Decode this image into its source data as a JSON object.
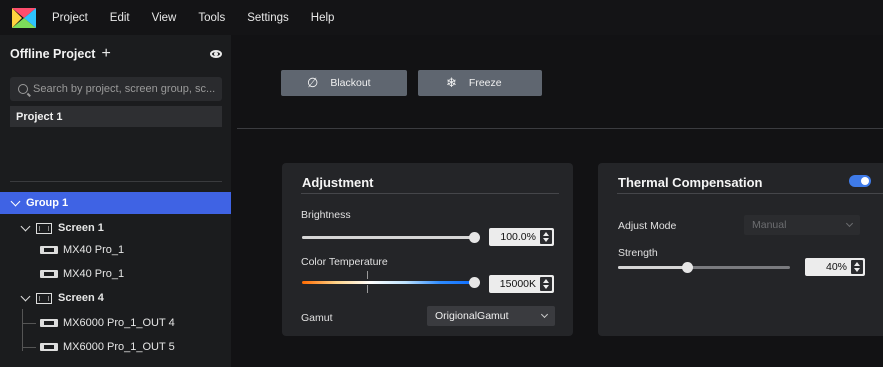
{
  "menu": {
    "items": [
      "Project",
      "Edit",
      "View",
      "Tools",
      "Settings",
      "Help"
    ]
  },
  "sidebar": {
    "title": "Offline Project",
    "add_icon": "plus-icon",
    "visibility_icon": "eye-icon",
    "search_placeholder": "Search by project, screen group, sc...",
    "projects": [
      {
        "label": "Project 1"
      }
    ],
    "tree": {
      "group": "Group 1",
      "screens": [
        {
          "label": "Screen 1",
          "children": [
            "MX40 Pro_1",
            "MX40 Pro_1"
          ]
        },
        {
          "label": "Screen 4",
          "children": [
            "MX6000 Pro_1_OUT 4",
            "MX6000 Pro_1_OUT 5"
          ]
        }
      ]
    }
  },
  "toolbar": {
    "blackout_label": "Blackout",
    "freeze_label": "Freeze"
  },
  "adjustment": {
    "title": "Adjustment",
    "brightness_label": "Brightness",
    "brightness_value": "100.0%",
    "brightness_level": 1.0,
    "color_temp_label": "Color Temperature",
    "color_temp_value": "15000K",
    "color_temp_level": 1.0,
    "gamut_label": "Gamut",
    "gamut_value": "OrigionalGamut"
  },
  "thermal": {
    "title": "Thermal Compensation",
    "enabled": true,
    "mode_label": "Adjust Mode",
    "mode_value": "Manual",
    "strength_label": "Strength",
    "strength_value": "40%",
    "strength_level": 0.4
  },
  "colors": {
    "accent": "#3f63e4",
    "toggle": "#3f7be9",
    "panel": "#242528",
    "button": "#5f6670"
  }
}
